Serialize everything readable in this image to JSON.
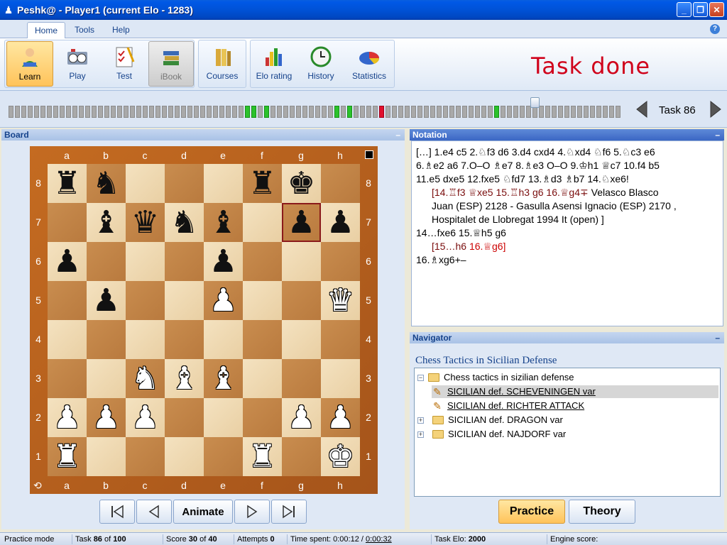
{
  "window": {
    "title": "Peshk@ - Player1 (current Elo - 1283)"
  },
  "ribbon": {
    "tabs": [
      "Home",
      "Tools",
      "Help"
    ],
    "buttons": {
      "learn": "Learn",
      "play": "Play",
      "test": "Test",
      "ibook": "iBook",
      "courses": "Courses",
      "elo": "Elo rating",
      "history": "History",
      "statistics": "Statistics"
    },
    "status_message": "Task done"
  },
  "progress": {
    "cells": 100,
    "ok_cells": [
      37,
      38,
      40,
      51,
      53,
      76
    ],
    "bad_cells": [
      58
    ],
    "current_task": 86
  },
  "task_nav": {
    "label": "Task 86"
  },
  "board": {
    "header": "Board",
    "files": [
      "a",
      "b",
      "c",
      "d",
      "e",
      "f",
      "g",
      "h"
    ],
    "ranks": [
      "8",
      "7",
      "6",
      "5",
      "4",
      "3",
      "2",
      "1"
    ],
    "position": [
      [
        "r",
        "n",
        "",
        "",
        "",
        "r",
        "k",
        ""
      ],
      [
        "",
        "b",
        "q",
        "n",
        "b",
        "",
        "p",
        "p"
      ],
      [
        "p",
        "",
        "",
        "",
        "p",
        "",
        "",
        ""
      ],
      [
        "",
        "p",
        "",
        "",
        "P",
        "",
        "",
        "Q"
      ],
      [
        "",
        "",
        "",
        "",
        "",
        "",
        "",
        ""
      ],
      [
        "",
        "",
        "N",
        "B",
        "B",
        "",
        "",
        ""
      ],
      [
        "P",
        "P",
        "P",
        "",
        "",
        "",
        "P",
        "P"
      ],
      [
        "R",
        "",
        "",
        "",
        "",
        "R",
        "",
        "K"
      ]
    ],
    "highlight": "g7",
    "controls": {
      "animate": "Animate"
    }
  },
  "notation": {
    "header": "Notation",
    "line1": "[…] 1.e4 c5 2.♘f3 d6 3.d4 cxd4 4.♘xd4 ♘f6 5.♘c3 e6",
    "line2": "6.♗e2 a6 7.O–O ♗e7 8.♗e3 O–O 9.♔h1 ♕c7 10.f4 b5",
    "line3": "11.e5 dxe5 12.fxe5 ♘fd7 13.♗d3 ♗b7 14.♘xe6!",
    "var1a": "[14.♖f3 ♕xe5 15.♖h3 g6 16.♕g4∓",
    "var1b": " Velasco Blasco",
    "var1c": "Juan (ESP) 2128  - Gasulla Asensi Ignacio (ESP) 2170 ,",
    "var1d": "Hospitalet de Llobregat 1994 It (open) ]",
    "line4": "14…fxe6 15.♕h5 g6",
    "var2a": "[15…h6 ",
    "var2b": "16.♕g6]",
    "line5": "16.♗xg6+–"
  },
  "navigator": {
    "header": "Navigator",
    "title": "Chess Tactics in Sicilian Defense",
    "root": "Chess tactics in sizilian defense",
    "items": [
      {
        "label": "SICILIAN def. SCHEVENINGEN var",
        "type": "task",
        "selected": true
      },
      {
        "label": "SICILIAN def. RICHTER ATTACK",
        "type": "task",
        "selected": false
      },
      {
        "label": "SICILIAN def. DRAGON var",
        "type": "folder",
        "selected": false
      },
      {
        "label": "SICILIAN def. NAJDORF var",
        "type": "folder",
        "selected": false
      }
    ],
    "practice": "Practice",
    "theory": "Theory"
  },
  "status": {
    "mode": "Practice mode",
    "task_prefix": "Task ",
    "task_num": "86",
    "task_of": " of ",
    "task_total": "100",
    "score_prefix": "Score ",
    "score_num": "30",
    "score_of": " of ",
    "score_total": "40",
    "attempts_prefix": "Attempts ",
    "attempts": "0",
    "time_prefix": "Time spent: 0:00:12 / ",
    "time_total": "0:00:32",
    "elo_prefix": "Task Elo: ",
    "elo": "2000",
    "engine": "Engine score:"
  },
  "colors": {
    "accent": "#15428b",
    "done": "#d0021b",
    "selected_btn": "#ffc35a"
  }
}
